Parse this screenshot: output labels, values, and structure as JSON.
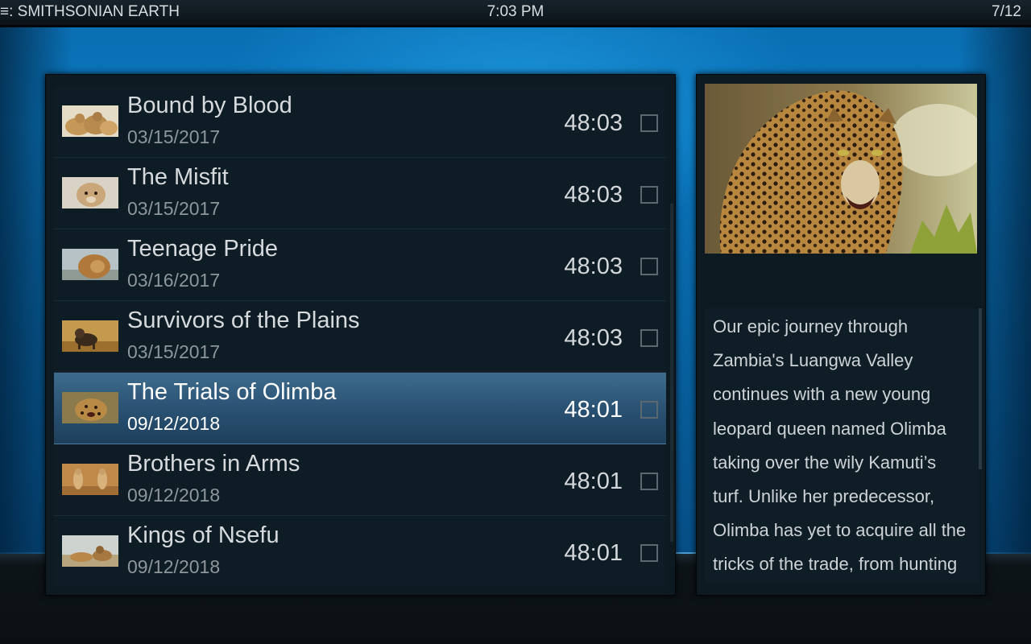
{
  "header": {
    "breadcrumb_icon": "≡",
    "breadcrumb": ": SMITHSONIAN EARTH",
    "clock": "7:03 PM",
    "item_counter": "7/12"
  },
  "episodes": [
    {
      "title": "Bound by Blood",
      "date": "03/15/2017",
      "duration": "48:03",
      "thumb_icon": "lions-thumb"
    },
    {
      "title": "The Misfit",
      "date": "03/15/2017",
      "duration": "48:03",
      "thumb_icon": "lion-cub-thumb"
    },
    {
      "title": "Teenage Pride",
      "date": "03/16/2017",
      "duration": "48:03",
      "thumb_icon": "lion-thumb"
    },
    {
      "title": "Survivors of the Plains",
      "date": "03/15/2017",
      "duration": "48:03",
      "thumb_icon": "hyena-thumb"
    },
    {
      "title": "The Trials of Olimba",
      "date": "09/12/2018",
      "duration": "48:01",
      "thumb_icon": "leopard-thumb",
      "selected": true
    },
    {
      "title": "Brothers in Arms",
      "date": "09/12/2018",
      "duration": "48:01",
      "thumb_icon": "cheetahs-thumb"
    },
    {
      "title": "Kings of Nsefu",
      "date": "09/12/2018",
      "duration": "48:01",
      "thumb_icon": "lions-resting-thumb"
    }
  ],
  "info": {
    "poster_icon": "leopard-poster",
    "plot": "Our epic journey through Zambia's Luangwa Valley continues with a new young leopard queen named Olimba taking over the wily Kamuti’s turf. Unlike her predecessor, Olimba has yet to acquire all the tricks of the trade, from hunting antelope to evading"
  },
  "colors": {
    "background_blue": "#0a76bd",
    "selection": "#2a5273",
    "panel": "#0d1a22"
  }
}
